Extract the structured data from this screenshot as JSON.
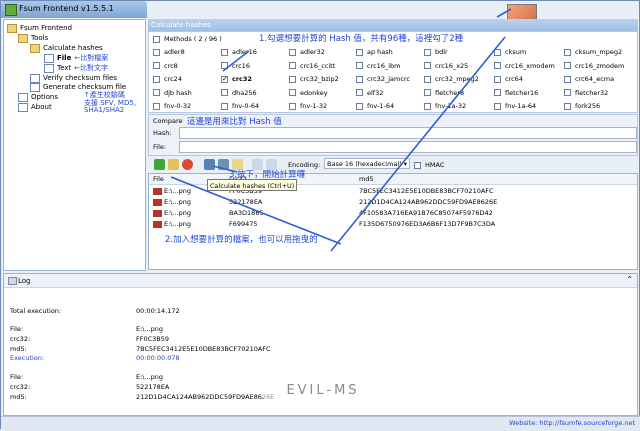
{
  "window": {
    "title": "Fsum Frontend v1.5.5.1"
  },
  "tree": {
    "items": [
      {
        "label": "Fsum Frontend"
      },
      {
        "label": "Tools"
      },
      {
        "label": "Calculate hashes"
      },
      {
        "label": "File"
      },
      {
        "label": "Text"
      },
      {
        "label": "Verify checksum files"
      },
      {
        "label": "Generate checksum file"
      },
      {
        "label": "Options"
      },
      {
        "label": "About"
      }
    ],
    "notes": {
      "file": "←比對檔案",
      "text": "←比對文字",
      "gen1": "↑產生校驗碼",
      "gen2": "支援 SFV, MD5,",
      "gen3": "SHA1/SHA2"
    }
  },
  "calculate": {
    "header": "Calculate hashes",
    "methods_label": "Methods ( 2 / 96 )",
    "methods": [
      [
        "adler8",
        "adler16",
        "adler32",
        "ap hash",
        "bdlr",
        "cksum",
        "cksum_mpeg2"
      ],
      [
        "crc8",
        "crc16",
        "crc16_ccitt",
        "crc16_ibm",
        "crc16_x25",
        "crc16_xmodem",
        "crc16_zmodem"
      ],
      [
        "crc24",
        "crc32",
        "crc32_bzip2",
        "crc32_jamcrc",
        "crc32_mpeg2",
        "crc64",
        "crc64_ecma"
      ],
      [
        "djb hash",
        "dha256",
        "edonkey",
        "elf32",
        "fletcher8",
        "fletcher16",
        "fletcher32"
      ],
      [
        "fnv-0-32",
        "fnv-0-64",
        "fnv-1-32",
        "fnv-1-64",
        "fnv-1a-32",
        "fnv-1a-64",
        "fork256"
      ]
    ],
    "checked": [
      "crc32",
      "md5"
    ]
  },
  "compare": {
    "title": "Compare",
    "hash_label": "Hash:",
    "file_label": "File:"
  },
  "toolbar": {
    "encoding_label": "Encoding:",
    "encoding_value": "Base 16 (hexadecimal)",
    "hmac_label": "HMAC",
    "tooltip": "Calculate hashes (Ctrl+U)"
  },
  "files": {
    "columns": [
      "File",
      "crc32",
      "md5"
    ],
    "rows": [
      {
        "file": "E:\\...png",
        "crc32": "FF0C3B59",
        "md5": "7BC5FEC3412E5E10DBE83BCF70210AFC"
      },
      {
        "file": "E:\\...png",
        "crc32": "522178EA",
        "md5": "212D1D4CA124AB962DDC59FD9AE8626E"
      },
      {
        "file": "E:\\...png",
        "crc32": "BA3D1865",
        "md5": "4F10583A716EA91B76C85074F5976D42"
      },
      {
        "file": "E:\\...png",
        "crc32": "F699475",
        "md5": "F135D6750976ED3A6B6F13D7F9B7C3DA"
      }
    ]
  },
  "log": {
    "title": "Log",
    "total_label": "Total execution:",
    "total_value": "00:00:14.172",
    "entries": [
      {
        "file": "E:\\...png",
        "crc32": "FF0C3B59",
        "md5": "7BC5FEC3412E5E10DBE83BCF70210AFC",
        "exec": "00:00:00.078"
      },
      {
        "file": "E:\\...png",
        "crc32": "522178EA",
        "md5": "212D1D4CA124AB962DDC59FD9AE8626E"
      }
    ],
    "labels": {
      "file": "File:",
      "crc32": "crc32:",
      "md5": "md5:",
      "exec": "Execution:"
    }
  },
  "status": {
    "website": "Website: http://fsumfe.sourceforge.net"
  },
  "annotations": {
    "a1": "1.勾選想要計算的 Hash 值，共有96種，這裡勾了2種",
    "a2": "2.加入想要計算的檔案，也可以用拖曳的",
    "a3": "3.按下，開始計算囉",
    "a4": "這邊是用來比對 Hash 值"
  },
  "watermark": "EVIL-MS"
}
